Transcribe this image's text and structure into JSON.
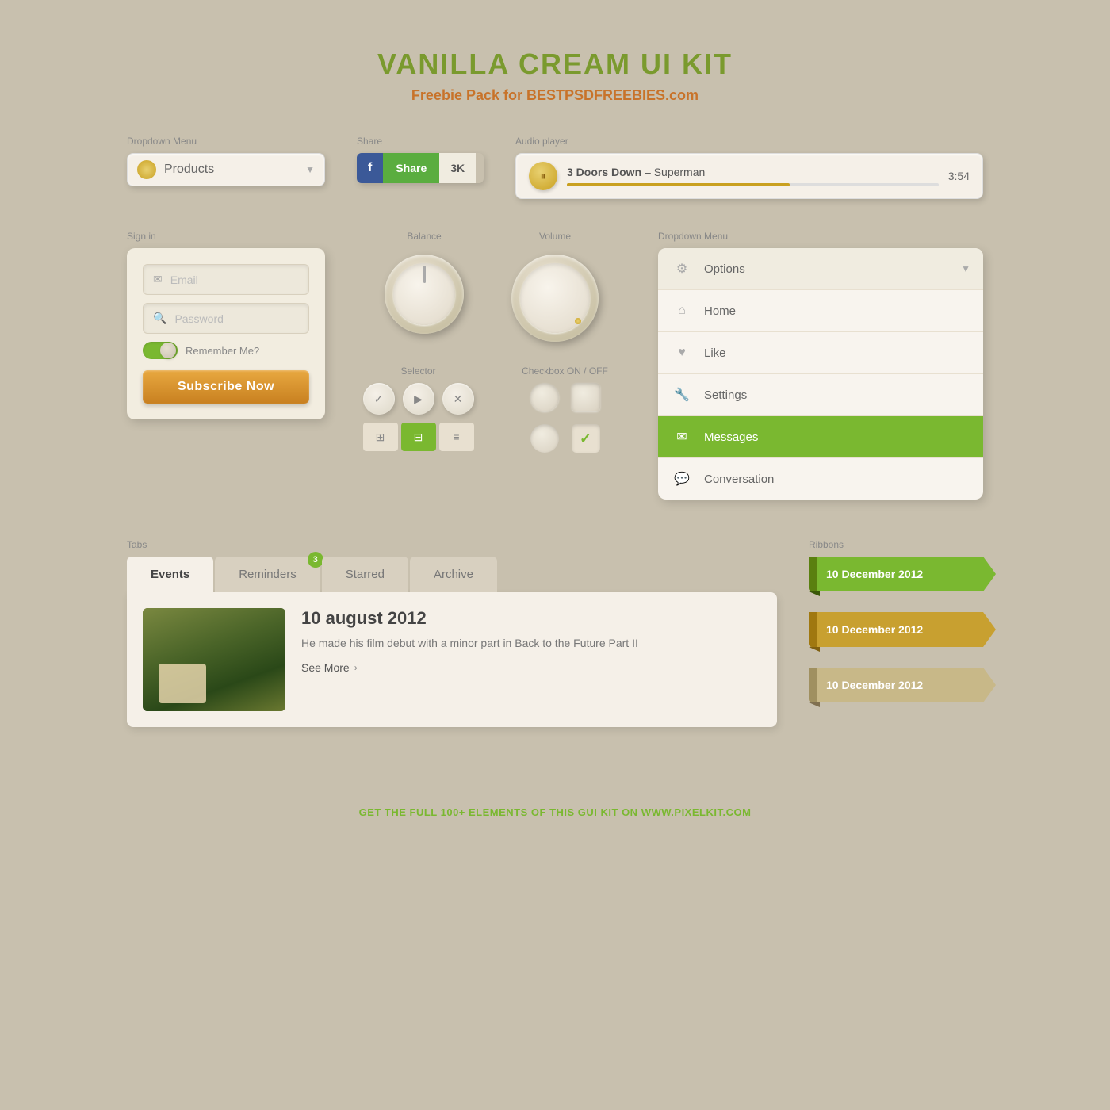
{
  "header": {
    "title": "VANILLA CREAM UI KIT",
    "subtitle_pre": "Freebie Pack for ",
    "subtitle_brand": "BESTPSDFREEBIES",
    "subtitle_post": ".com"
  },
  "dropdown1": {
    "label": "Dropdown Menu",
    "selected": "Products",
    "arrow": "▼"
  },
  "share": {
    "label": "Share",
    "fb_icon": "f",
    "btn_text": "Share",
    "count": "3K"
  },
  "audio": {
    "label": "Audio player",
    "title_strong": "3 Doors Down",
    "title_rest": " – Superman",
    "time": "3:54"
  },
  "signin": {
    "label": "Sign in",
    "email_placeholder": "Email",
    "password_placeholder": "Password",
    "remember_label": "Remember Me?",
    "subscribe_btn": "Subscribe Now"
  },
  "balance": {
    "label": "Balance"
  },
  "volume": {
    "label": "Volume"
  },
  "selector": {
    "label": "Selector",
    "btns": [
      "✓",
      "▶",
      "✕"
    ],
    "view_icons": [
      "⊞",
      "⊟",
      "≡"
    ]
  },
  "checkbox": {
    "label": "Checkbox ON / OFF"
  },
  "dropdown2": {
    "label": "Dropdown Menu",
    "items": [
      {
        "icon": "⚙",
        "text": "Options",
        "hasArrow": true,
        "active": false
      },
      {
        "icon": "⌂",
        "text": "Home",
        "hasArrow": false,
        "active": false
      },
      {
        "icon": "♥",
        "text": "Like",
        "hasArrow": false,
        "active": false
      },
      {
        "icon": "🔧",
        "text": "Settings",
        "hasArrow": false,
        "active": false
      },
      {
        "icon": "✉",
        "text": "Messages",
        "hasArrow": false,
        "active": true
      },
      {
        "icon": "💬",
        "text": "Conversation",
        "hasArrow": false,
        "active": false
      }
    ]
  },
  "tabs": {
    "label": "Tabs",
    "items": [
      {
        "text": "Events",
        "active": true,
        "badge": null
      },
      {
        "text": "Reminders",
        "active": false,
        "badge": "3"
      },
      {
        "text": "Starred",
        "active": false,
        "badge": null
      },
      {
        "text": "Archive",
        "active": false,
        "badge": null
      }
    ],
    "event": {
      "date": "10 august 2012",
      "description": "He made his film debut with a minor part in Back to the Future Part II",
      "see_more": "See More"
    }
  },
  "ribbons": {
    "label": "Ribbons",
    "items": [
      {
        "text": "10 December 2012",
        "color": "green"
      },
      {
        "text": "10 December 2012",
        "color": "gold"
      },
      {
        "text": "10 December 2012",
        "color": "tan"
      }
    ]
  },
  "footer": {
    "pre": "GET THE FULL 100+ ELEMENTS OF THIS GUI KIT ON ",
    "link": "WWW.PIXELKIT.COM"
  }
}
